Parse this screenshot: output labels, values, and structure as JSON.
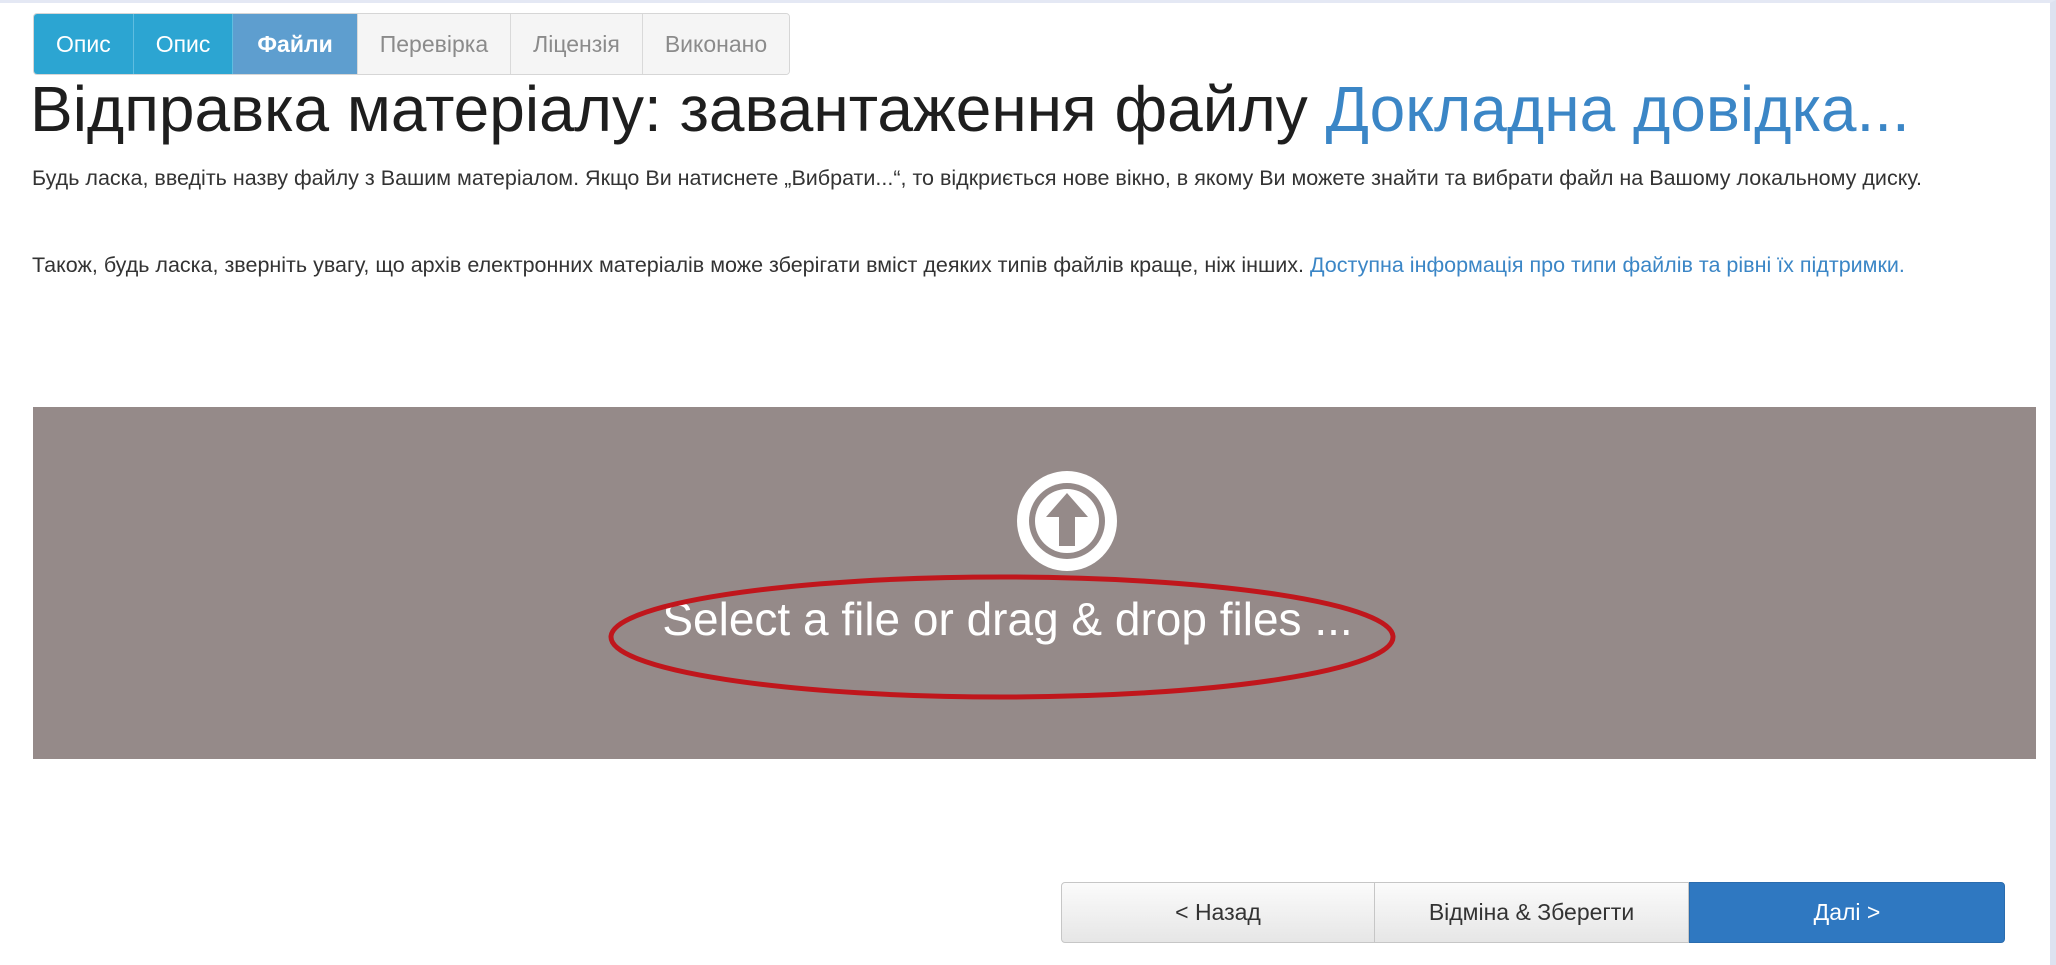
{
  "steps": [
    {
      "label": "Опис",
      "state": "done"
    },
    {
      "label": "Опис",
      "state": "done"
    },
    {
      "label": "Файли",
      "state": "current"
    },
    {
      "label": "Перевірка",
      "state": "todo"
    },
    {
      "label": "Ліцензія",
      "state": "todo"
    },
    {
      "label": "Виконано",
      "state": "todo"
    }
  ],
  "heading": {
    "title": "Відправка матеріалу: завантаження файлу ",
    "help_link": "Докладна довідка..."
  },
  "instructions": {
    "paragraph1": "Будь ласка, введіть назву файлу з Вашим матеріалом. Якщо Ви натиснете „Вибрати...“, то відкриється нове вікно, в якому Ви можете знайти та вибрати файл на Вашому локальному диску.",
    "paragraph2": "Також, будь ласка, зверніть увагу, що архів електронних матеріалів може зберігати вміст деяких типів файлів краще, ніж інших. ",
    "formats_link": "Доступна інформація про типи файлів та рівні їх підтримки."
  },
  "dropzone": {
    "text": "Select a file or drag & drop files ...",
    "icon": "upload-arrow-icon",
    "background_color": "#958a89",
    "highlight_color": "#c0161c"
  },
  "buttons": {
    "back": "< Назад",
    "save": "Відміна & Зберегти",
    "next": "Далі >"
  },
  "colors": {
    "step_done": "#2ca5d2",
    "step_current": "#5e9ecf",
    "link": "#3b86c6",
    "primary_button": "#2f78c1"
  }
}
